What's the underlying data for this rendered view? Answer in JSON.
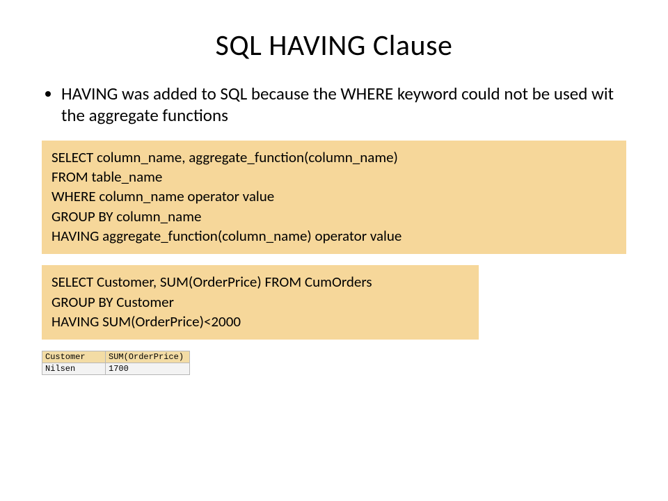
{
  "title": "SQL HAVING Clause",
  "bullet": "HAVING was added to SQL because the WHERE keyword could not be used wit the aggregate functions",
  "syntax": {
    "l1": "SELECT column_name, aggregate_function(column_name)",
    "l2": "FROM table_name",
    "l3": "WHERE column_name operator value",
    "l4": "GROUP BY column_name",
    "l5": "HAVING aggregate_function(column_name) operator value"
  },
  "example": {
    "l1": "SELECT Customer, SUM(OrderPrice) FROM CumOrders",
    "l2": "GROUP BY Customer",
    "l3": "HAVING SUM(OrderPrice)<2000"
  },
  "table": {
    "h1": "Customer",
    "h2": "SUM(OrderPrice)",
    "r1c1": "Nilsen",
    "r1c2": "1700"
  }
}
